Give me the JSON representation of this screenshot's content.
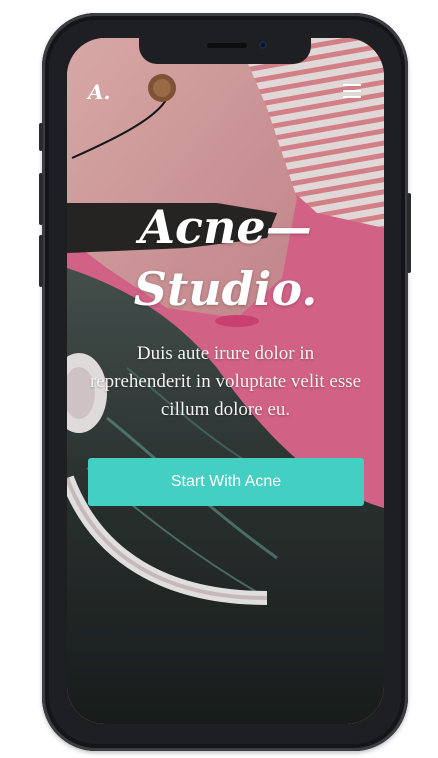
{
  "app": {
    "logo_text": "A.",
    "menu_icon": "hamburger-menu-icon"
  },
  "hero": {
    "title_line1": "Acne—",
    "title_line2": "Studio.",
    "subtitle": "Duis aute irure dolor in reprehenderit in voluptate velit esse cillum dolore eu.",
    "cta_label": "Start With Acne"
  },
  "colors": {
    "accent": "#44cfc3",
    "background_pink": "#e46a92",
    "device_frame": "#1e1f22"
  }
}
